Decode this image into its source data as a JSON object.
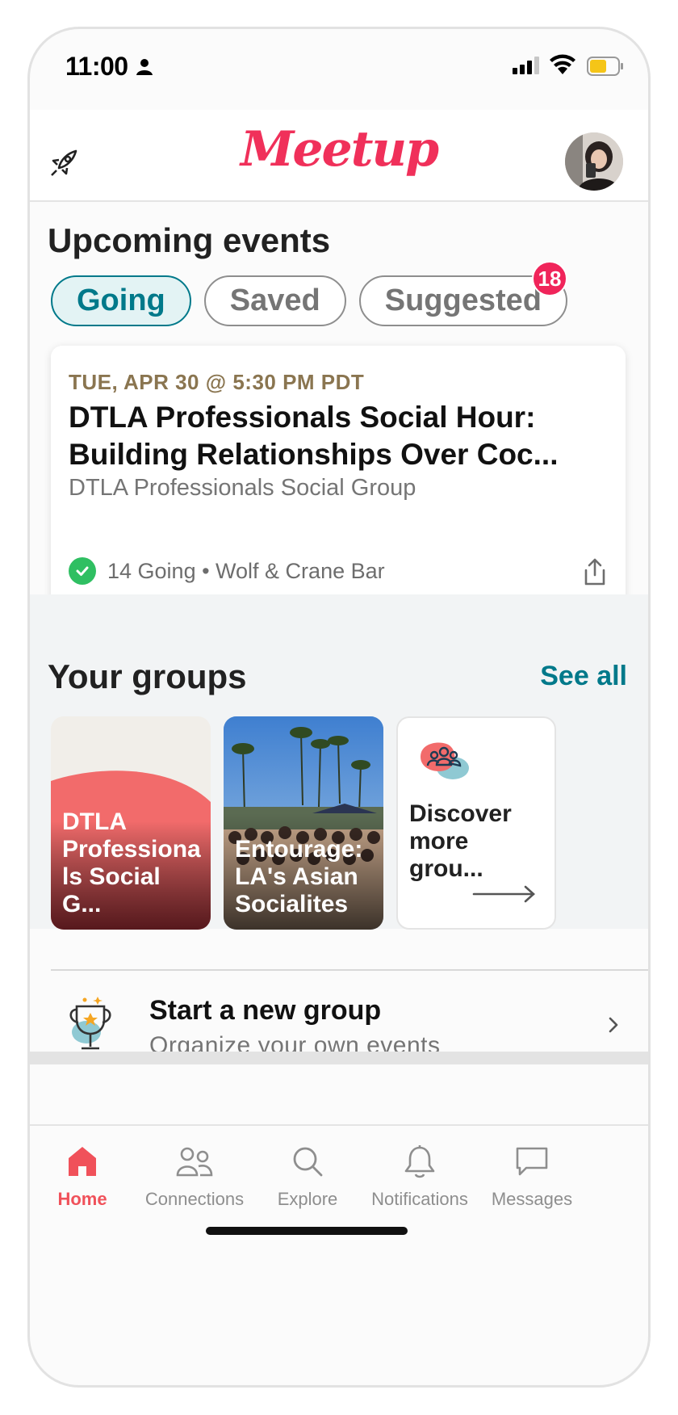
{
  "status_bar": {
    "time": "11:00"
  },
  "header": {
    "logo": "Meetup"
  },
  "upcoming": {
    "title": "Upcoming events",
    "chips": [
      {
        "label": "Going",
        "active": true
      },
      {
        "label": "Saved",
        "active": false
      },
      {
        "label": "Suggested",
        "active": false,
        "badge": "18"
      }
    ]
  },
  "event": {
    "date": "TUE, APR 30 @ 5:30 PM PDT",
    "title_line1": "DTLA Professionals Social Hour:",
    "title_line2": "Building Relationships Over Coc...",
    "group": "DTLA Professionals Social Group",
    "meta": "14 Going • Wolf & Crane Bar"
  },
  "groups": {
    "title": "Your groups",
    "see_all": "See all",
    "items": [
      {
        "name": "DTLA Professiona ls Social G..."
      },
      {
        "name": "Entourage: LA's Asian Socialites"
      }
    ],
    "discover": "Discover more grou..."
  },
  "new_group": {
    "title": "Start a new group",
    "subtitle": "Organize your own events"
  },
  "tabs": [
    {
      "label": "Home",
      "icon": "home-icon",
      "active": true
    },
    {
      "label": "Connections",
      "icon": "people-icon"
    },
    {
      "label": "Explore",
      "icon": "search-icon"
    },
    {
      "label": "Notifications",
      "icon": "bell-icon"
    },
    {
      "label": "Messages",
      "icon": "chat-icon"
    }
  ],
  "colors": {
    "brand": "#f0305a",
    "teal": "#00798a",
    "active_tab": "#f0515a"
  }
}
